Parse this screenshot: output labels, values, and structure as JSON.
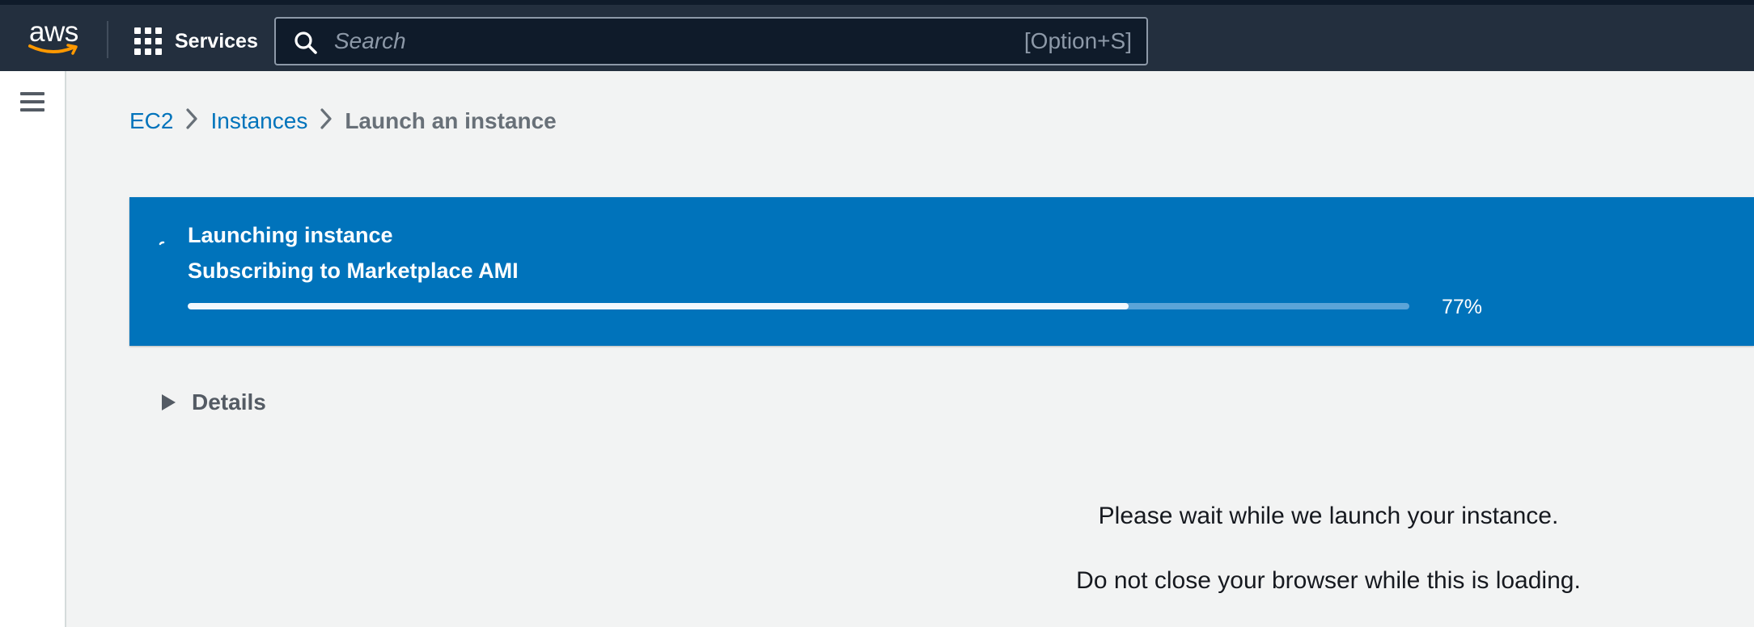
{
  "topbar": {
    "logo_text": "aws",
    "services_label": "Services",
    "search": {
      "placeholder": "Search",
      "value": "",
      "shortcut": "[Option+S]"
    }
  },
  "colors": {
    "topbar_bg": "#232f3e",
    "flash_bg": "#0073bb",
    "link": "#0073bb",
    "aws_smile": "#ff9900"
  },
  "breadcrumb": {
    "items": [
      {
        "label": "EC2"
      },
      {
        "label": "Instances"
      },
      {
        "label": "Launch an instance"
      }
    ]
  },
  "flash": {
    "title": "Launching instance",
    "subtitle": "Subscribing to Marketplace AMI",
    "progress_percent": 77,
    "progress_label": "77%"
  },
  "details": {
    "label": "Details",
    "expanded": false
  },
  "messages": {
    "line1": "Please wait while we launch your instance.",
    "line2": "Do not close your browser while this is loading."
  },
  "icons": {
    "logo": "aws-smile-logo",
    "services": "grid-icon",
    "search": "search-icon",
    "menu": "hamburger-icon",
    "breadcrumb_separator": "chevron-right-icon",
    "loading": "spinner-icon",
    "expand": "caret-right-icon"
  }
}
